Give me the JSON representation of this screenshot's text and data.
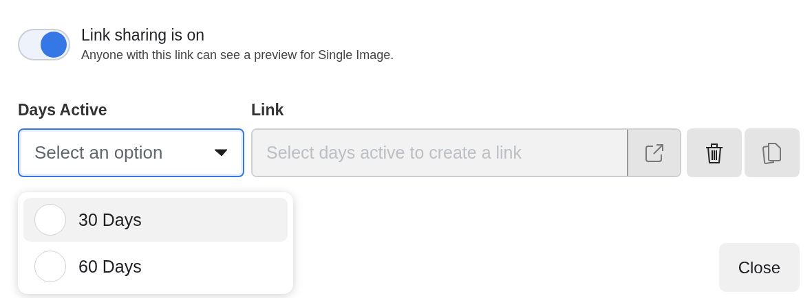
{
  "sharing": {
    "on": true,
    "title": "Link sharing is on",
    "description": "Anyone with this link can see a preview for Single Image."
  },
  "days_active": {
    "label": "Days Active",
    "placeholder": "Select an option",
    "expanded": true,
    "options": [
      {
        "label": "30 Days",
        "selected": false,
        "hovered": true
      },
      {
        "label": "60 Days",
        "selected": false,
        "hovered": false
      }
    ]
  },
  "link": {
    "label": "Link",
    "placeholder": "Select days active to create a link",
    "disabled": true
  },
  "buttons": [
    {
      "label": "Close"
    }
  ]
}
